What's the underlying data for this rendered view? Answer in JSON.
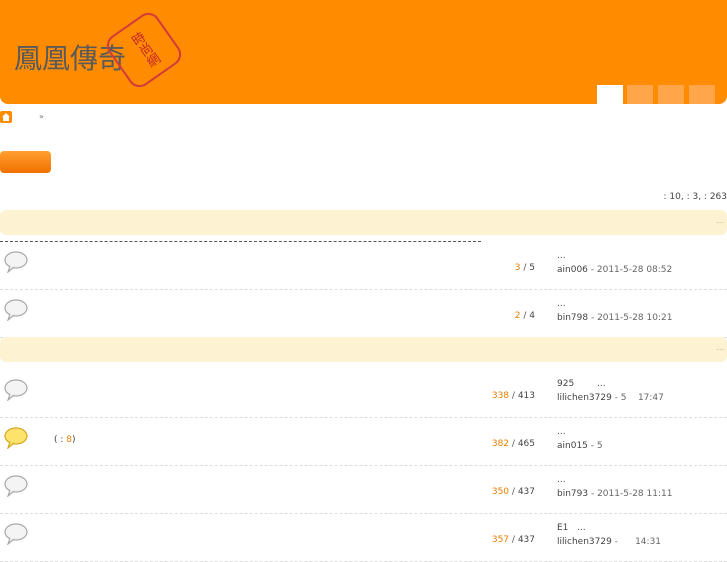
{
  "header": {
    "logo_text": "鳳凰傳奇",
    "stamp_text": "時尚網",
    "colors": {
      "header_bg": "#ff8c00",
      "accent": "#e67e00",
      "section_bg": "#fdf3d2"
    }
  },
  "breadcrumb": {
    "home_icon": "home-icon",
    "separator": "»"
  },
  "stats": {
    "text": ": 10,   : 3,   : 263"
  },
  "sections": [
    {
      "more": "..."
    },
    {
      "more": "..."
    }
  ],
  "threads": [
    {
      "bubble": "gray",
      "note": "",
      "replies": "3",
      "views": "5",
      "last_title": "...",
      "last_author": "ain006",
      "last_time": " - 2011-5-28 08:52"
    },
    {
      "bubble": "gray",
      "note": "",
      "replies": "2",
      "views": "4",
      "last_title": "...",
      "last_author": "bin798",
      "last_time": " - 2011-5-28 10:21"
    },
    {
      "bubble": "gray",
      "note": "",
      "replies": "338",
      "views": "413",
      "last_title": "925        ...",
      "last_author": "lilichen3729",
      "last_time": " - 5    17:47"
    },
    {
      "bubble": "yellow",
      "note_prefix": "( : ",
      "note_value": "8",
      "note_suffix": ")",
      "replies": "382",
      "views": "465",
      "last_title": "...",
      "last_author": "ain015",
      "last_time": " - 5"
    },
    {
      "bubble": "gray",
      "note": "",
      "replies": "350",
      "views": "437",
      "last_title": "...",
      "last_author": "bin793",
      "last_time": " - 2011-5-28 11:11"
    },
    {
      "bubble": "gray",
      "note": "",
      "replies": "357",
      "views": "437",
      "last_title": "E1   ...",
      "last_author": "lilichen3729",
      "last_time": " -      14:31"
    }
  ]
}
